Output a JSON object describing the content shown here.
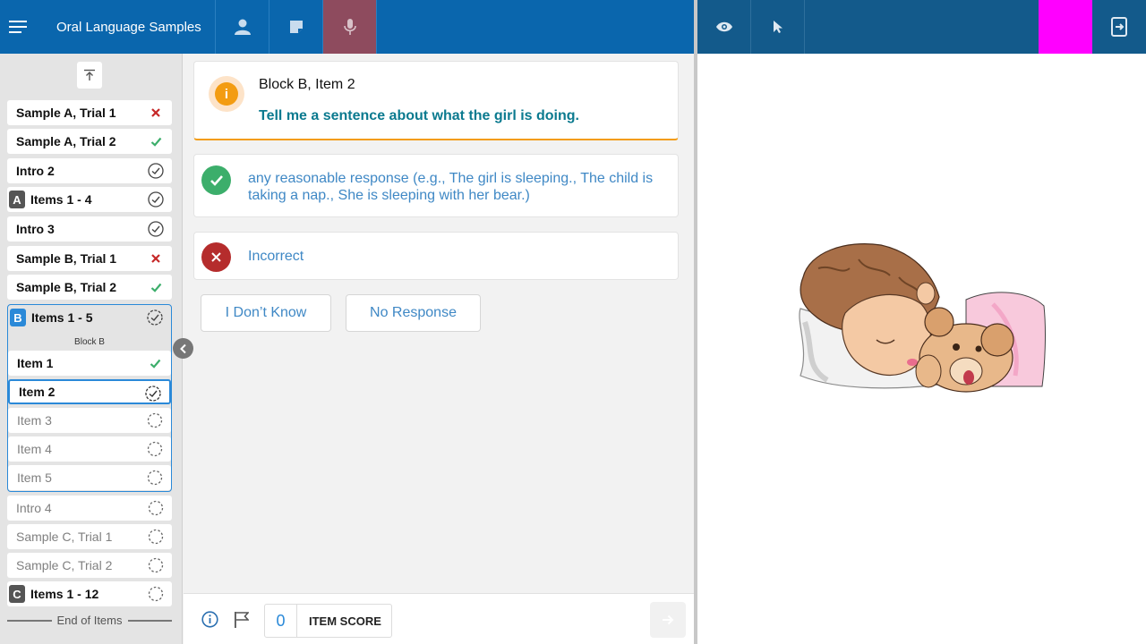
{
  "header": {
    "title": "Oral Language Samples",
    "icons": [
      "menu-icon",
      "user-icon",
      "note-icon",
      "microphone-icon"
    ],
    "right_icons": [
      "eye-icon",
      "pointer-icon",
      "exit-icon"
    ]
  },
  "sidebar": {
    "items": [
      {
        "label": "Sample A, Trial 1",
        "status": "incorrect"
      },
      {
        "label": "Sample A, Trial 2",
        "status": "correct"
      },
      {
        "label": "Intro 2",
        "status": "complete"
      },
      {
        "badge": "A",
        "label": "Items 1 - 4",
        "status": "complete"
      },
      {
        "label": "Intro 3",
        "status": "complete"
      },
      {
        "label": "Sample B, Trial 1",
        "status": "incorrect"
      },
      {
        "label": "Sample B, Trial 2",
        "status": "correct"
      }
    ],
    "group": {
      "badge": "B",
      "label": "Items 1 - 5",
      "block_label": "Block B",
      "items": [
        {
          "label": "Item 1",
          "status": "correct"
        },
        {
          "label": "Item 2",
          "status": "in-progress",
          "current": true
        },
        {
          "label": "Item 3",
          "status": "pending"
        },
        {
          "label": "Item 4",
          "status": "pending"
        },
        {
          "label": "Item 5",
          "status": "pending"
        }
      ]
    },
    "after": [
      {
        "label": "Intro 4",
        "status": "pending"
      },
      {
        "label": "Sample C, Trial 1",
        "status": "pending"
      },
      {
        "label": "Sample C, Trial 2",
        "status": "pending"
      },
      {
        "badge": "C",
        "label": "Items 1 - 12",
        "status": "pending"
      }
    ],
    "end_label": "End of Items"
  },
  "main": {
    "prompt_title": "Block B, Item 2",
    "prompt_text": "Tell me a sentence about what the girl is doing.",
    "correct_response": "any reasonable response (e.g., The girl is sleeping., The child is taking a nap., She is sleeping with her bear.)",
    "incorrect_response": "Incorrect",
    "dont_know_label": "I Don’t Know",
    "no_response_label": "No Response"
  },
  "footer": {
    "score_value": "0",
    "score_label": "ITEM SCORE"
  },
  "colors": {
    "primary": "#0a66ad",
    "accent": "#2a89d8",
    "correct": "#3cae6b",
    "incorrect": "#b52c2c",
    "warning": "#f39c12",
    "highlight": "#ff00ff"
  }
}
